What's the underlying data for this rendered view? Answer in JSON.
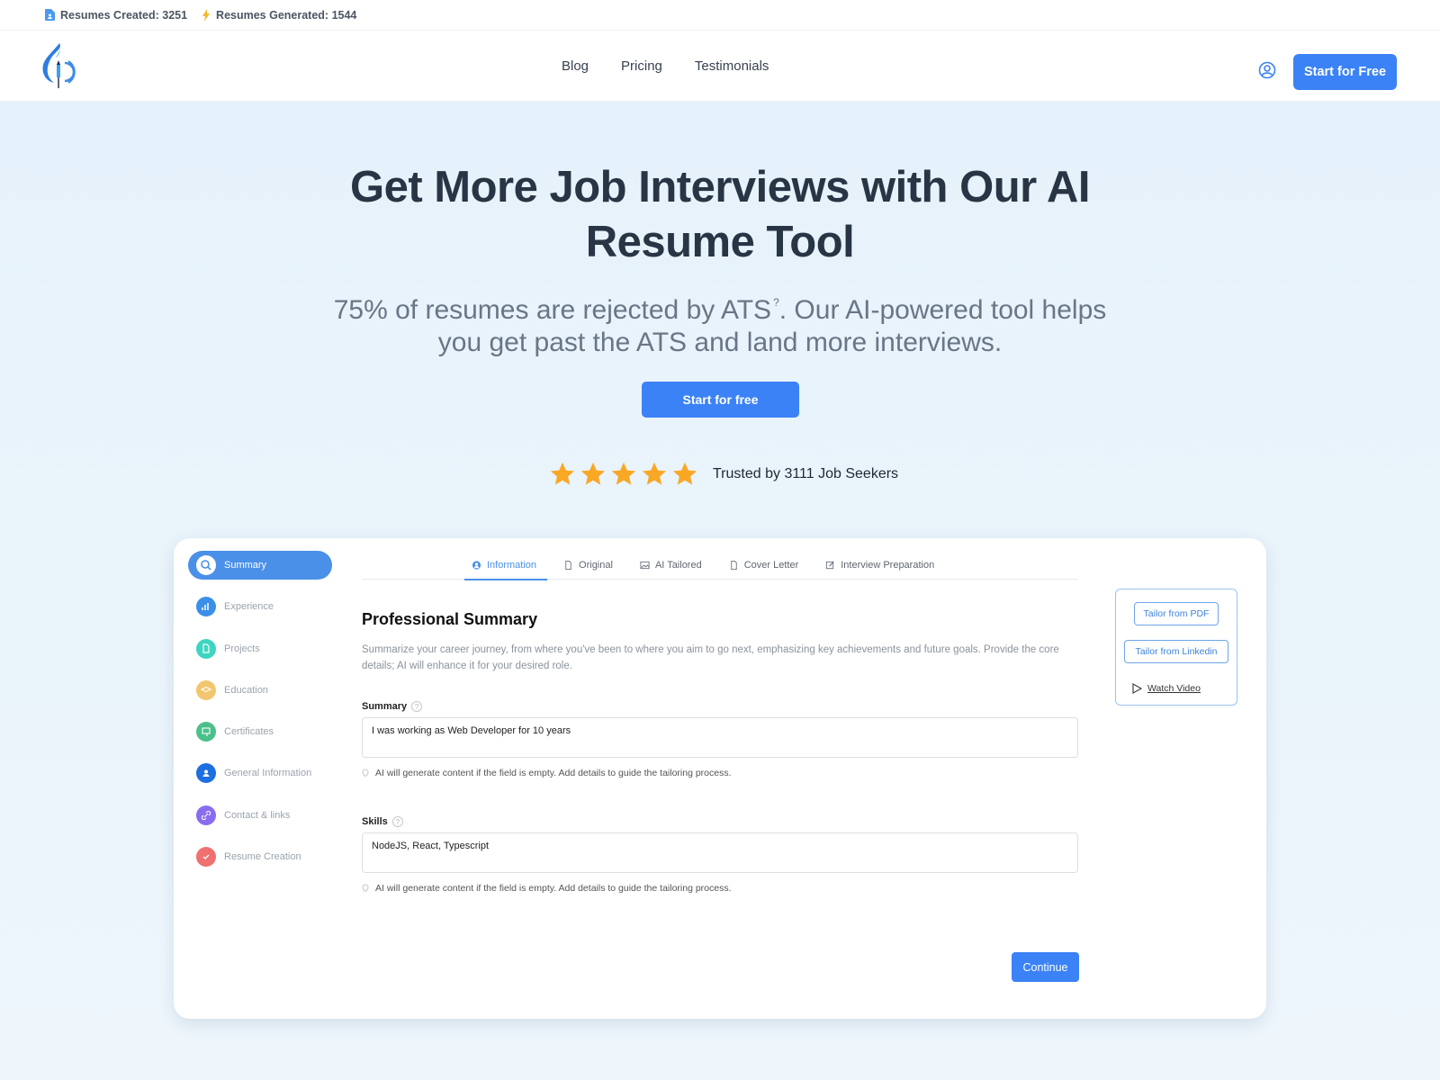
{
  "topbar": {
    "resumes_created": "Resumes Created: 3251",
    "resumes_generated": "Resumes Generated: 1544"
  },
  "nav": {
    "links": [
      "Blog",
      "Pricing",
      "Testimonials"
    ],
    "cta": "Start for Free"
  },
  "hero": {
    "title": "Get More Job Interviews with Our AI Resume Tool",
    "subtitle_part1": "75% of resumes are rejected by ATS",
    "subtitle_sup": "?",
    "subtitle_part2": ". Our AI-powered tool helps you get past the ATS and land more interviews.",
    "cta": "Start for free",
    "rating_stars": 5,
    "trusted_text": "Trusted by 3111 Job Seekers"
  },
  "colors": {
    "accent": "#3b82f6",
    "star": "#f9a826",
    "heading": "#283544"
  },
  "app": {
    "sidebar": [
      {
        "label": "Summary",
        "icon": "search-icon",
        "color": "#ffffff",
        "active": true
      },
      {
        "label": "Experience",
        "icon": "bar-chart-icon",
        "color": "#3b8fe8"
      },
      {
        "label": "Projects",
        "icon": "document-icon",
        "color": "#3fd5c0"
      },
      {
        "label": "Education",
        "icon": "graduation-cap-icon",
        "color": "#f2c66f"
      },
      {
        "label": "Certificates",
        "icon": "certificate-icon",
        "color": "#4cc08a"
      },
      {
        "label": "General Information",
        "icon": "user-icon",
        "color": "#1e6fe0"
      },
      {
        "label": "Contact & links",
        "icon": "link-icon",
        "color": "#8a6cf0"
      },
      {
        "label": "Resume Creation",
        "icon": "check-icon",
        "color": "#f07070"
      }
    ],
    "tabs": [
      {
        "label": "Information",
        "icon": "user-circle-icon",
        "active": true
      },
      {
        "label": "Original",
        "icon": "file-icon"
      },
      {
        "label": "AI Tailored",
        "icon": "image-icon"
      },
      {
        "label": "Cover Letter",
        "icon": "file-icon"
      },
      {
        "label": "Interview Preparation",
        "icon": "edit-icon"
      }
    ],
    "section_title": "Professional Summary",
    "section_desc": "Summarize your career journey, from where you've been to where you aim to go next, emphasizing key achievements and future goals. Provide the core details; AI will enhance it for your desired role.",
    "summary_label": "Summary",
    "summary_value": "I was working as Web Developer for 10 years",
    "summary_hint": "AI will generate content if the field is empty. Add details to guide the tailoring process.",
    "skills_label": "Skills",
    "skills_value": "NodeJS, React, Typescript",
    "skills_hint": "AI will generate content if the field is empty. Add details to guide the tailoring process.",
    "continue": "Continue",
    "tailor_pdf": "Tailor from PDF",
    "tailor_linkedin": "Tailor from Linkedin",
    "watch_video": "Watch Video"
  }
}
